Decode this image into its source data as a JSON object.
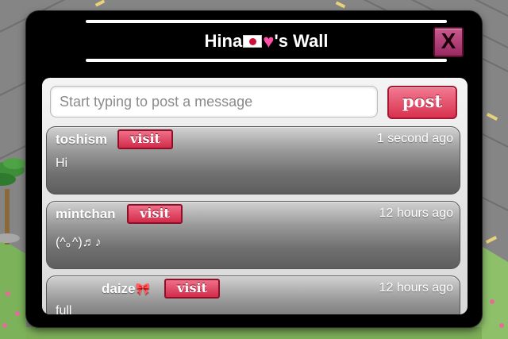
{
  "wall": {
    "owner_name": "Hina",
    "title_suffix": "'s Wall",
    "close_label": "X"
  },
  "composer": {
    "placeholder": "Start typing to post a message",
    "post_label": "post"
  },
  "messages": [
    {
      "user": "toshism",
      "visit_label": "visit",
      "time": "1 second ago",
      "text": "Hi"
    },
    {
      "user": "mintchan",
      "visit_label": "visit",
      "time": "12 hours ago",
      "text": "(^｡^)♬♪"
    },
    {
      "user": "daize",
      "visit_label": "visit",
      "time": "12 hours ago",
      "text": "full"
    }
  ],
  "colors": {
    "modal_bg": "#000000",
    "accent_pink": "#d8324f",
    "close_magenta": "#9a2a62"
  },
  "icons": [
    "japan-flag-icon",
    "pink-heart-icon",
    "ribbon-bow-icon"
  ]
}
